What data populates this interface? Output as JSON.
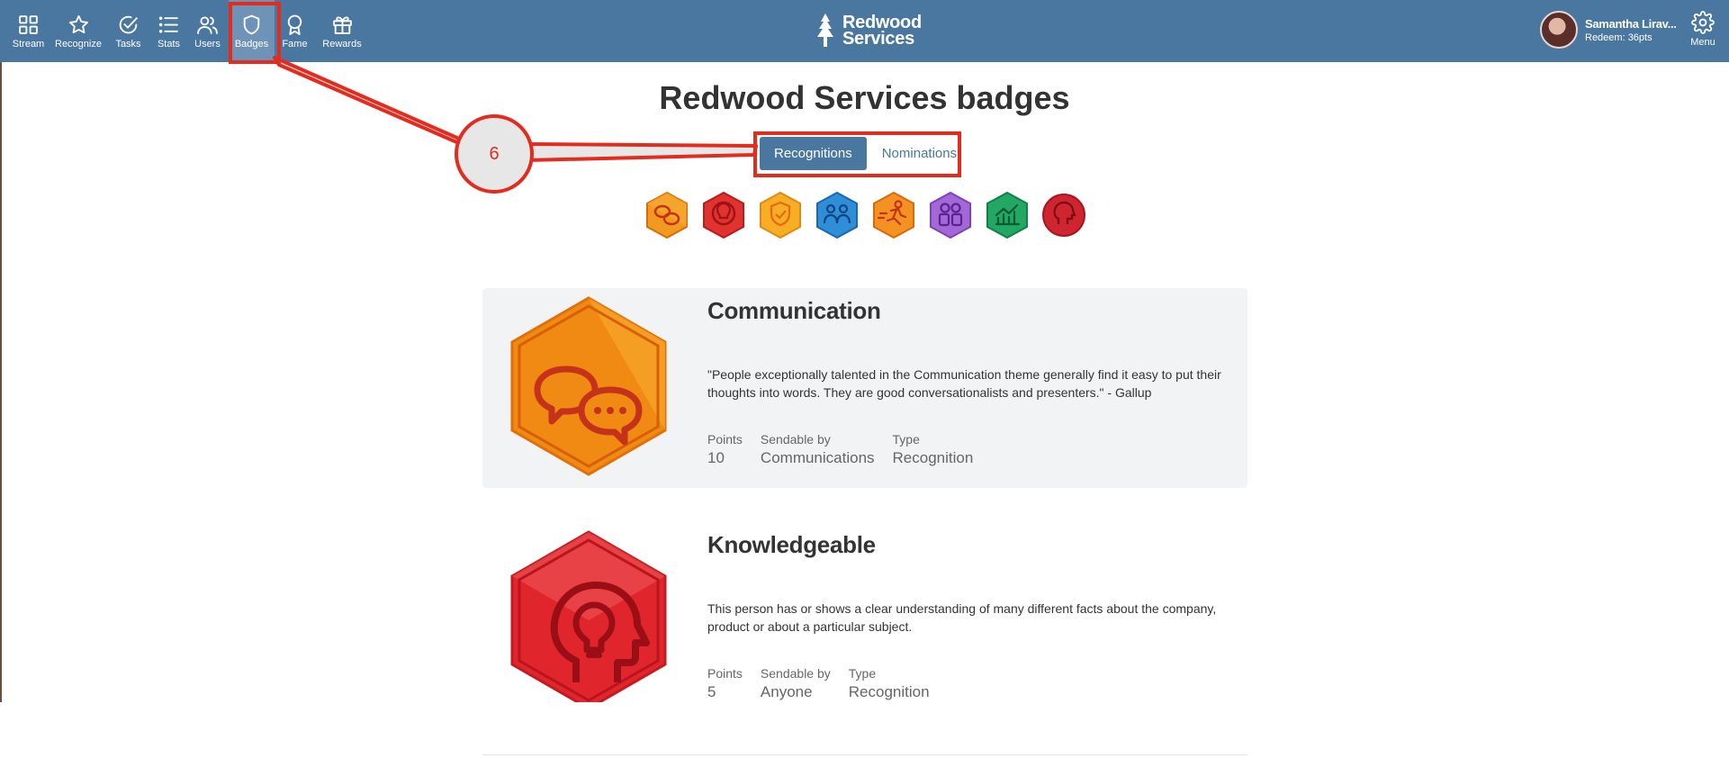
{
  "nav": {
    "items": [
      {
        "label": "Stream",
        "icon": "grid-icon"
      },
      {
        "label": "Recognize",
        "icon": "star-icon"
      },
      {
        "label": "Tasks",
        "icon": "check-circle-icon"
      },
      {
        "label": "Stats",
        "icon": "list-icon"
      },
      {
        "label": "Users",
        "icon": "users-icon"
      },
      {
        "label": "Badges",
        "icon": "shield-icon"
      },
      {
        "label": "Fame",
        "icon": "ribbon-icon"
      },
      {
        "label": "Rewards",
        "icon": "gift-icon"
      }
    ],
    "active": "Badges"
  },
  "brand": {
    "line1": "Redwood",
    "line2": "Services",
    "icon": "tree-logo"
  },
  "user": {
    "name": "Samantha Lirav...",
    "points": "Redeem: 36pts"
  },
  "menu": {
    "label": "Menu",
    "icon": "gear-icon"
  },
  "page": {
    "title": "Redwood Services badges"
  },
  "tabs": [
    {
      "label": "Recognitions",
      "active": true
    },
    {
      "label": "Nominations",
      "active": false
    }
  ],
  "badge_strip": [
    {
      "name": "Communication",
      "color": "#f08c1a",
      "icon": "speech-bubbles-icon"
    },
    {
      "name": "Knowledgeable",
      "color": "#d9262c",
      "icon": "lightbulb-head-icon"
    },
    {
      "name": "Dependable",
      "color": "#f5a51c",
      "icon": "shield-check-icon"
    },
    {
      "name": "Teamwork",
      "color": "#2a86d1",
      "icon": "people-icon"
    },
    {
      "name": "Go-getter",
      "color": "#f08c1a",
      "icon": "runner-icon"
    },
    {
      "name": "Mentorship",
      "color": "#9b59d0",
      "icon": "pair-icon"
    },
    {
      "name": "Growth",
      "color": "#1ea25c",
      "icon": "chart-icon"
    },
    {
      "name": "Leadership",
      "color": "#c8202a",
      "icon": "head-star-icon"
    }
  ],
  "cards": [
    {
      "title": "Communication",
      "description": "\"People exceptionally talented in the Communication theme generally find it easy to put their thoughts into words. They are good conversationalists and presenters.\" - Gallup",
      "meta": [
        {
          "label": "Points",
          "value": "10"
        },
        {
          "label": "Sendable by",
          "value": "Communications"
        },
        {
          "label": "Type",
          "value": "Recognition"
        }
      ]
    },
    {
      "title": "Knowledgeable",
      "description": "This person has or shows a clear understanding of many different facts about the company, product or about a particular subject.",
      "meta": [
        {
          "label": "Points",
          "value": "5"
        },
        {
          "label": "Sendable by",
          "value": "Anyone"
        },
        {
          "label": "Type",
          "value": "Recognition"
        }
      ]
    }
  ],
  "annotation": {
    "step": "6",
    "color": "#e32b1e"
  }
}
